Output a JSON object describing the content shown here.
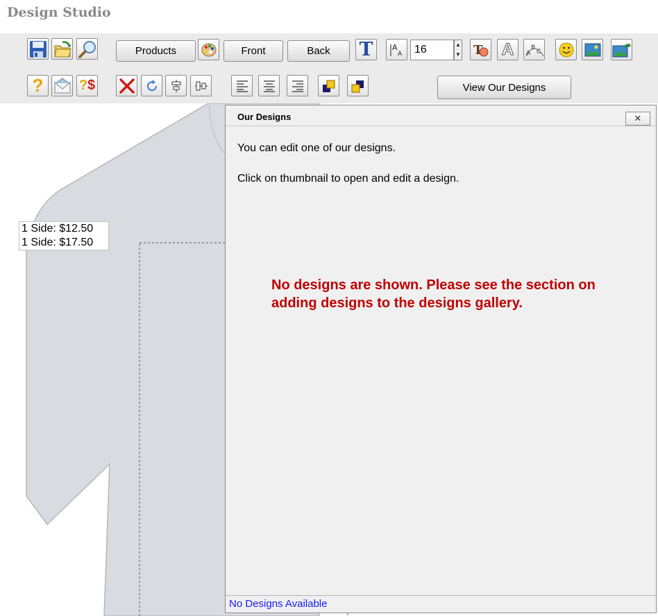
{
  "app": {
    "title": "Design Studio"
  },
  "toolbar": {
    "products_label": "Products",
    "front_label": "Front",
    "back_label": "Back",
    "font_size_value": "16",
    "view_designs_label": "View Our Designs",
    "icons": {
      "save": "save-icon",
      "open": "open-folder-icon",
      "zoom": "magnifier-icon",
      "color": "color-palette-icon",
      "text": "text-icon",
      "font_size": "font-size-icon",
      "text_color": "text-color-icon",
      "outline": "outline-text-icon",
      "arc_text": "arc-text-icon",
      "clipart": "smiley-icon",
      "image": "image-icon",
      "upload_image": "upload-image-icon",
      "help": "help-icon",
      "email": "email-icon",
      "price": "price-icon",
      "delete": "delete-icon",
      "rotate": "rotate-icon",
      "center_vertical": "center-vertical-icon",
      "center_horizontal": "center-horizontal-icon",
      "align_left": "align-left-icon",
      "align_center": "align-center-icon",
      "align_right": "align-right-icon",
      "bring_forward": "bring-forward-icon",
      "send_backward": "send-backward-icon"
    }
  },
  "canvas": {
    "price_lines": [
      "1 Side: $12.50",
      "1 Side: $17.50"
    ]
  },
  "dialog": {
    "title": "Our Designs",
    "close_label": "✕",
    "line1": "You can edit one of our designs.",
    "line2": "Click on thumbnail to open and edit a design.",
    "notice": "No designs are shown. Please see the section on adding designs to the designs gallery.",
    "status": "No Designs Available"
  },
  "colors": {
    "notice": "#c00000",
    "status_link": "#1a1aff",
    "shirt": "#d9dbe0",
    "toolbar_bg": "#ebebeb"
  }
}
